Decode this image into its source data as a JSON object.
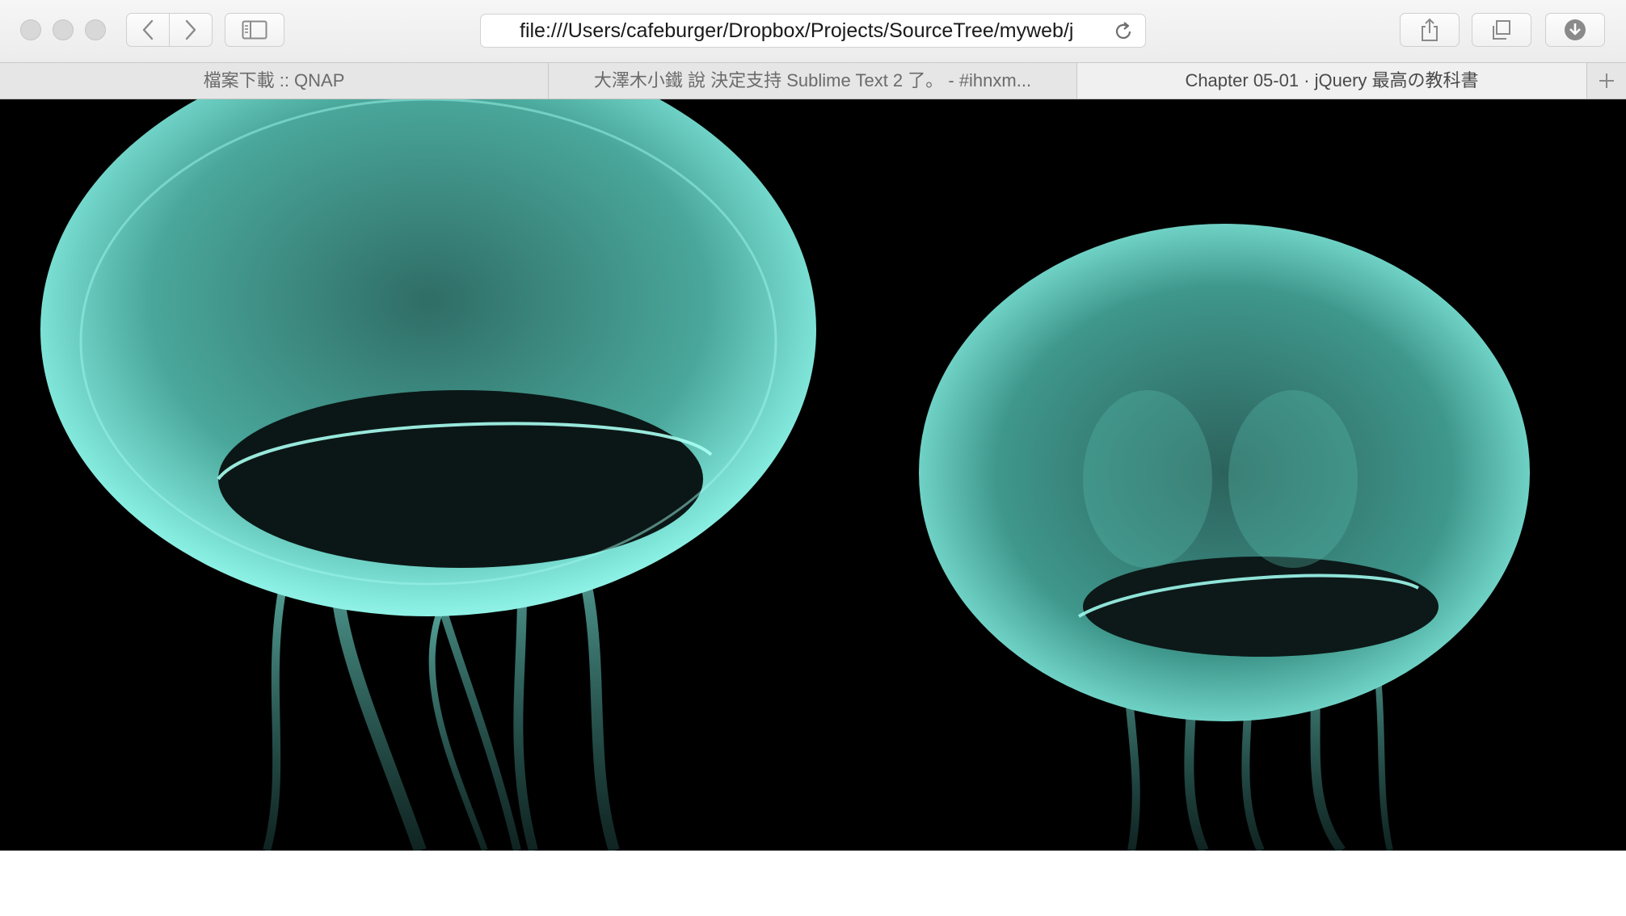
{
  "window": {
    "traffic_lights": [
      "close",
      "minimize",
      "zoom"
    ]
  },
  "toolbar": {
    "back_icon": "chevron-left-icon",
    "forward_icon": "chevron-right-icon",
    "sidebar_icon": "sidebar-icon",
    "share_icon": "share-icon",
    "tabs_icon": "tab-overview-icon",
    "downloads_icon": "download-icon"
  },
  "address_bar": {
    "url": "file:///Users/cafeburger/Dropbox/Projects/SourceTree/myweb/j",
    "reload_icon": "reload-icon"
  },
  "tabs": [
    {
      "label": "檔案下載 :: QNAP",
      "active": false
    },
    {
      "label": "大澤木小鐵 說 決定支持 Sublime Text 2 了。 - #ihnxm...",
      "active": false
    },
    {
      "label": "Chapter 05-01 · jQuery 最高の教科書",
      "active": true
    }
  ],
  "new_tab_icon": "plus-icon",
  "page": {
    "image": "jellyfish-photo"
  },
  "colors": {
    "jelly": "#7fe0d2",
    "background": "#000000"
  }
}
